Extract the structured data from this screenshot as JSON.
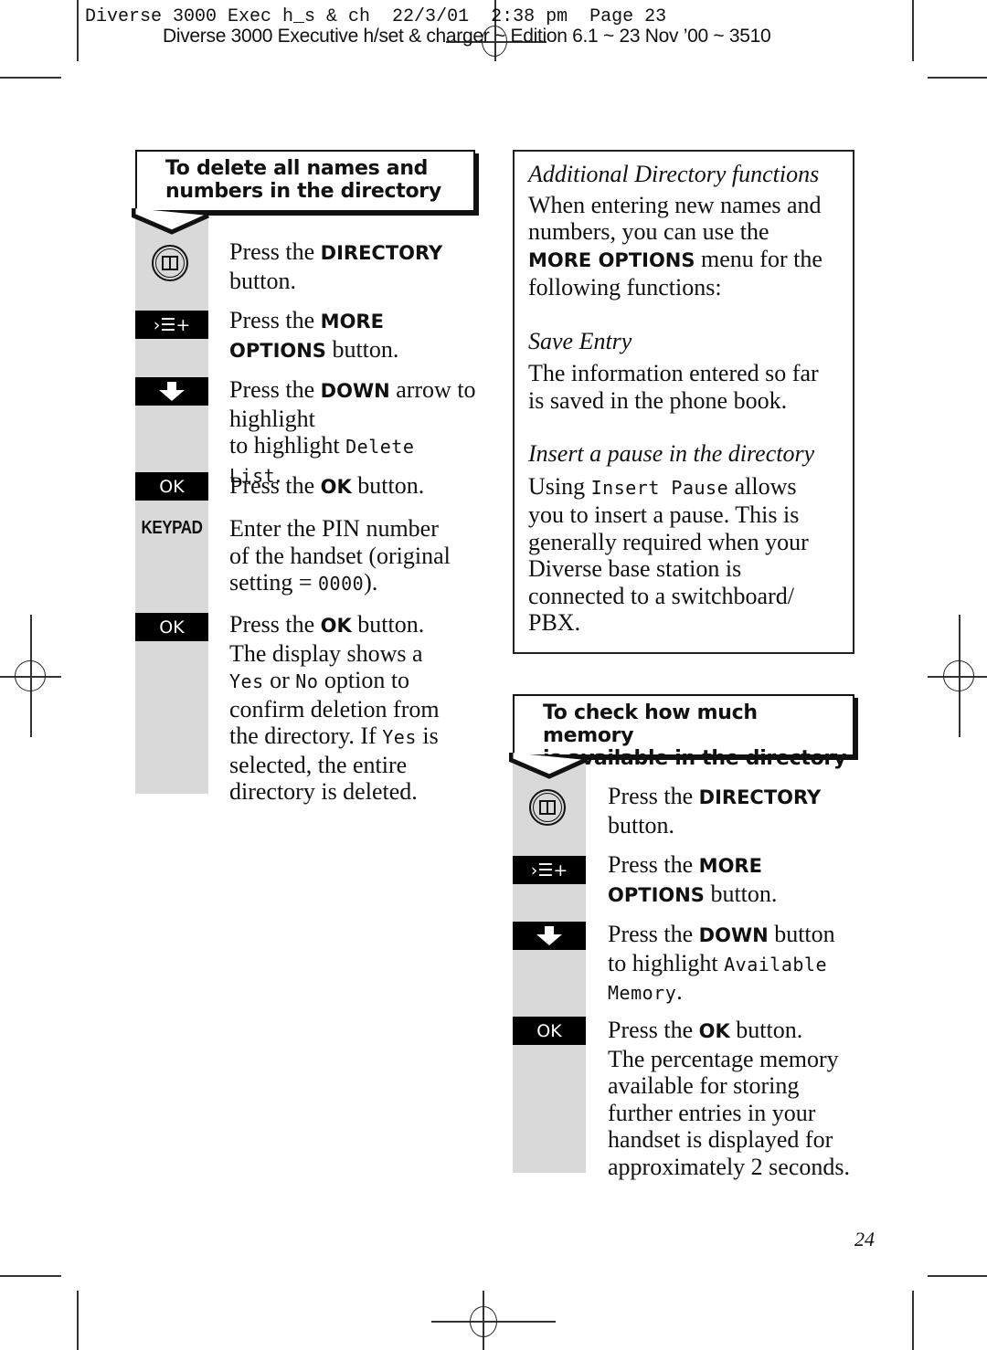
{
  "slug": {
    "line1": "Diverse 3000 Exec h_s & ch  22/3/01  2:38 pm  Page 23",
    "line2": "Diverse 3000 Executive h/set & charger ~ Edition 6.1 ~ 23 Nov ’00 ~ 3510"
  },
  "left_section": {
    "title_line1": "To delete all names and",
    "title_line2": "numbers in the directory",
    "steps": [
      {
        "key": "directory-icon",
        "parts": [
          "Press the ",
          "DIRECTORY",
          " button."
        ]
      },
      {
        "key": "more-options-icon",
        "key_label": "›☰+",
        "parts": [
          "Press the ",
          "MORE OPTIONS",
          " button."
        ]
      },
      {
        "key": "down-arrow-icon",
        "key_label": "🡇",
        "parts": [
          "Press the ",
          "DOWN",
          " arrow to highlight ",
          "Delete List",
          "."
        ]
      },
      {
        "key": "ok",
        "key_label": "OK",
        "parts": [
          "Press the ",
          "OK",
          " button."
        ]
      },
      {
        "key": "keypad",
        "key_label": "KEYPAD",
        "parts": [
          "Enter the PIN number of the handset (original setting = ",
          "0000",
          ")."
        ]
      },
      {
        "key": "ok",
        "key_label": "OK",
        "parts": [
          "Press the ",
          "OK",
          " button. The display shows a ",
          "Yes",
          " or ",
          "No",
          " option to confirm deletion from the directory. If ",
          "Yes",
          " is selected, the entire directory is deleted."
        ]
      }
    ]
  },
  "info_box": {
    "heading": "Additional Directory functions",
    "intro_a": "When entering new names and numbers, you can use the ",
    "intro_bold": "MORE OPTIONS",
    "intro_b": " menu for the following functions:",
    "save_heading": "Save Entry",
    "save_text": "The information entered so far is saved in the phone book.",
    "pause_heading": "Insert a pause in the directory",
    "pause_a": "Using ",
    "pause_lcd": "Insert Pause",
    "pause_b": " allows you to insert a pause. This is generally required when your Diverse base station is connected to a switchboard/ PBX."
  },
  "right_section": {
    "title_line1": "To check how much memory",
    "title_line2": "is available in the directory",
    "steps": [
      {
        "key": "directory-icon",
        "parts": [
          "Press the ",
          "DIRECTORY",
          " button."
        ]
      },
      {
        "key": "more-options-icon",
        "key_label": "›☰+",
        "parts": [
          "Press the ",
          "MORE OPTIONS",
          " button."
        ]
      },
      {
        "key": "down-arrow-icon",
        "key_label": "🡇",
        "parts": [
          "Press the ",
          "DOWN",
          " button to highlight ",
          "Available Memory",
          "."
        ]
      },
      {
        "key": "ok",
        "key_label": "OK",
        "parts": [
          "Press the ",
          "OK",
          " button. The percentage memory available for storing further entries in your handset is displayed for approximately 2 seconds."
        ]
      }
    ]
  },
  "page_number": "24"
}
